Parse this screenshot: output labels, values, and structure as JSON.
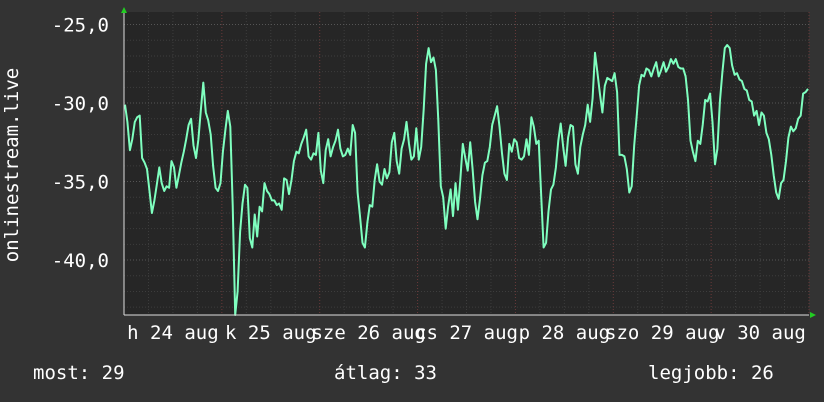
{
  "chart_data": {
    "type": "line",
    "ylabel": "onlinestream.live",
    "ylim": [
      -43.5,
      -24.2
    ],
    "y_ticks": [
      {
        "value": -25,
        "label": "-25,0"
      },
      {
        "value": -30,
        "label": "-30,0"
      },
      {
        "value": -35,
        "label": "-35,0"
      },
      {
        "value": -40,
        "label": "-40,0"
      }
    ],
    "x_ticks": [
      "h 24 aug",
      "k 25 aug",
      "sze 26 aug",
      "cs 27 aug",
      "p 28 aug",
      "szo 29 aug",
      "v 30 aug"
    ],
    "grid": true,
    "colors": {
      "background": "#333333",
      "plot": "#262626",
      "line": "#7fffbf",
      "grid_minor": "#3d3d3d",
      "grid_major_x": "#6a3a3a",
      "arrow": "#22cc22"
    },
    "series": [
      {
        "values": [
          -30.1,
          -31.2,
          -33,
          -32.3,
          -31.2,
          -30.9,
          -30.8,
          -33.5,
          -33.8,
          -34.2,
          -35.6,
          -37,
          -36.2,
          -35.2,
          -34.1,
          -35.1,
          -35.6,
          -35.3,
          -35.4,
          -33.7,
          -34.1,
          -35.4,
          -34.6,
          -33.8,
          -33.1,
          -32.3,
          -31.4,
          -31,
          -32.7,
          -33.5,
          -32.3,
          -30.4,
          -28.7,
          -30.6,
          -31.1,
          -32,
          -34,
          -35.4,
          -35.6,
          -35.1,
          -33.1,
          -31.7,
          -30.5,
          -31.5,
          -36.5,
          -43.5,
          -42,
          -38.2,
          -36.4,
          -35.2,
          -35.4,
          -38.6,
          -39.2,
          -37.1,
          -38.5,
          -36.6,
          -36.9,
          -35.1,
          -35.6,
          -35.8,
          -36.2,
          -36.2,
          -36.5,
          -36.4,
          -36.8,
          -34.8,
          -34.9,
          -35.8,
          -34.9,
          -33.7,
          -33.1,
          -33.2,
          -32.6,
          -32.2,
          -31.7,
          -33.4,
          -33.6,
          -33.2,
          -33.3,
          -31.9,
          -34.3,
          -35.1,
          -33,
          -32.3,
          -33.4,
          -32.8,
          -32.4,
          -31.7,
          -32.9,
          -33.4,
          -33.3,
          -32.9,
          -33.3,
          -31.4,
          -31.9,
          -35.7,
          -37.2,
          -38.9,
          -39.2,
          -37.6,
          -36.5,
          -36.6,
          -34.9,
          -33.9,
          -35,
          -35.2,
          -34.2,
          -34.8,
          -34.4,
          -32.5,
          -31.9,
          -33.7,
          -34.5,
          -32.9,
          -32.3,
          -31.2,
          -32.6,
          -33.6,
          -33.4,
          -31.6,
          -33.6,
          -32.8,
          -30.4,
          -27.5,
          -26.5,
          -27.4,
          -27.1,
          -27.9,
          -31.1,
          -35.3,
          -36,
          -38,
          -36.6,
          -35.5,
          -37.2,
          -35.1,
          -36.8,
          -34.8,
          -32.6,
          -33.5,
          -34.3,
          -32.5,
          -34.2,
          -36.3,
          -37.4,
          -36.1,
          -34.6,
          -33.8,
          -33.7,
          -32.8,
          -31.4,
          -30.8,
          -30.2,
          -31.5,
          -33.2,
          -34.5,
          -34.9,
          -32.6,
          -33.1,
          -32.3,
          -32.5,
          -33.5,
          -33.6,
          -33.4,
          -32.3,
          -33.3,
          -30.9,
          -31.5,
          -32.6,
          -32.4,
          -35.9,
          -39.2,
          -38.9,
          -36.9,
          -35.5,
          -35.2,
          -34.1,
          -32.4,
          -31.3,
          -32.8,
          -34,
          -32.2,
          -31.4,
          -31.5,
          -33.9,
          -34.5,
          -32.8,
          -32,
          -31.4,
          -30.1,
          -31.2,
          -29.7,
          -26.8,
          -28.1,
          -29.4,
          -30.6,
          -28.9,
          -28.4,
          -28.5,
          -28.6,
          -28.1,
          -29.3,
          -33.3,
          -33.3,
          -33.4,
          -34.2,
          -35.7,
          -35.3,
          -32.7,
          -30.9,
          -28.9,
          -28.2,
          -28.3,
          -27.8,
          -27.9,
          -28.3,
          -27.8,
          -27.4,
          -28.3,
          -27.9,
          -27.4,
          -28,
          -27.7,
          -27.2,
          -27.5,
          -27.2,
          -27.7,
          -27.8,
          -27.8,
          -28.3,
          -29.8,
          -32.4,
          -33.1,
          -33.7,
          -32.4,
          -32.6,
          -31.4,
          -29.8,
          -29.9,
          -29.4,
          -31.2,
          -33.9,
          -32.9,
          -29.9,
          -28.1,
          -26.5,
          -26.3,
          -26.5,
          -27.6,
          -28.2,
          -28.1,
          -28.5,
          -28.6,
          -29.1,
          -29.2,
          -29.8,
          -29.9,
          -30.8,
          -30.5,
          -31.4,
          -30.6,
          -30.8,
          -31.9,
          -32.3,
          -33.3,
          -34.6,
          -35.7,
          -36.1,
          -35.1,
          -34.9,
          -33.7,
          -32.2,
          -31.5,
          -31.8,
          -31.6,
          -31,
          -30.8,
          -29.4,
          -29.3,
          -29.1
        ]
      }
    ]
  },
  "stats": {
    "now": "most: 29",
    "avg": "átlag: 33",
    "max": "legjobb: 26"
  }
}
